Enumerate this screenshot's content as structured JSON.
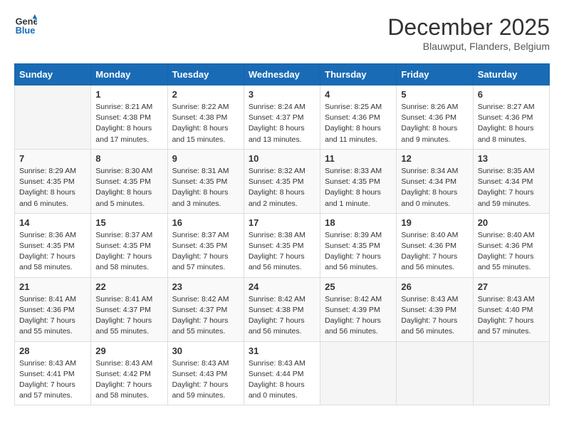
{
  "logo": {
    "line1": "General",
    "line2": "Blue"
  },
  "title": "December 2025",
  "subtitle": "Blauwput, Flanders, Belgium",
  "days_header": [
    "Sunday",
    "Monday",
    "Tuesday",
    "Wednesday",
    "Thursday",
    "Friday",
    "Saturday"
  ],
  "weeks": [
    [
      {
        "day": "",
        "info": ""
      },
      {
        "day": "1",
        "info": "Sunrise: 8:21 AM\nSunset: 4:38 PM\nDaylight: 8 hours\nand 17 minutes."
      },
      {
        "day": "2",
        "info": "Sunrise: 8:22 AM\nSunset: 4:38 PM\nDaylight: 8 hours\nand 15 minutes."
      },
      {
        "day": "3",
        "info": "Sunrise: 8:24 AM\nSunset: 4:37 PM\nDaylight: 8 hours\nand 13 minutes."
      },
      {
        "day": "4",
        "info": "Sunrise: 8:25 AM\nSunset: 4:36 PM\nDaylight: 8 hours\nand 11 minutes."
      },
      {
        "day": "5",
        "info": "Sunrise: 8:26 AM\nSunset: 4:36 PM\nDaylight: 8 hours\nand 9 minutes."
      },
      {
        "day": "6",
        "info": "Sunrise: 8:27 AM\nSunset: 4:36 PM\nDaylight: 8 hours\nand 8 minutes."
      }
    ],
    [
      {
        "day": "7",
        "info": "Sunrise: 8:29 AM\nSunset: 4:35 PM\nDaylight: 8 hours\nand 6 minutes."
      },
      {
        "day": "8",
        "info": "Sunrise: 8:30 AM\nSunset: 4:35 PM\nDaylight: 8 hours\nand 5 minutes."
      },
      {
        "day": "9",
        "info": "Sunrise: 8:31 AM\nSunset: 4:35 PM\nDaylight: 8 hours\nand 3 minutes."
      },
      {
        "day": "10",
        "info": "Sunrise: 8:32 AM\nSunset: 4:35 PM\nDaylight: 8 hours\nand 2 minutes."
      },
      {
        "day": "11",
        "info": "Sunrise: 8:33 AM\nSunset: 4:35 PM\nDaylight: 8 hours\nand 1 minute."
      },
      {
        "day": "12",
        "info": "Sunrise: 8:34 AM\nSunset: 4:34 PM\nDaylight: 8 hours\nand 0 minutes."
      },
      {
        "day": "13",
        "info": "Sunrise: 8:35 AM\nSunset: 4:34 PM\nDaylight: 7 hours\nand 59 minutes."
      }
    ],
    [
      {
        "day": "14",
        "info": "Sunrise: 8:36 AM\nSunset: 4:35 PM\nDaylight: 7 hours\nand 58 minutes."
      },
      {
        "day": "15",
        "info": "Sunrise: 8:37 AM\nSunset: 4:35 PM\nDaylight: 7 hours\nand 58 minutes."
      },
      {
        "day": "16",
        "info": "Sunrise: 8:37 AM\nSunset: 4:35 PM\nDaylight: 7 hours\nand 57 minutes."
      },
      {
        "day": "17",
        "info": "Sunrise: 8:38 AM\nSunset: 4:35 PM\nDaylight: 7 hours\nand 56 minutes."
      },
      {
        "day": "18",
        "info": "Sunrise: 8:39 AM\nSunset: 4:35 PM\nDaylight: 7 hours\nand 56 minutes."
      },
      {
        "day": "19",
        "info": "Sunrise: 8:40 AM\nSunset: 4:36 PM\nDaylight: 7 hours\nand 56 minutes."
      },
      {
        "day": "20",
        "info": "Sunrise: 8:40 AM\nSunset: 4:36 PM\nDaylight: 7 hours\nand 55 minutes."
      }
    ],
    [
      {
        "day": "21",
        "info": "Sunrise: 8:41 AM\nSunset: 4:36 PM\nDaylight: 7 hours\nand 55 minutes."
      },
      {
        "day": "22",
        "info": "Sunrise: 8:41 AM\nSunset: 4:37 PM\nDaylight: 7 hours\nand 55 minutes."
      },
      {
        "day": "23",
        "info": "Sunrise: 8:42 AM\nSunset: 4:37 PM\nDaylight: 7 hours\nand 55 minutes."
      },
      {
        "day": "24",
        "info": "Sunrise: 8:42 AM\nSunset: 4:38 PM\nDaylight: 7 hours\nand 56 minutes."
      },
      {
        "day": "25",
        "info": "Sunrise: 8:42 AM\nSunset: 4:39 PM\nDaylight: 7 hours\nand 56 minutes."
      },
      {
        "day": "26",
        "info": "Sunrise: 8:43 AM\nSunset: 4:39 PM\nDaylight: 7 hours\nand 56 minutes."
      },
      {
        "day": "27",
        "info": "Sunrise: 8:43 AM\nSunset: 4:40 PM\nDaylight: 7 hours\nand 57 minutes."
      }
    ],
    [
      {
        "day": "28",
        "info": "Sunrise: 8:43 AM\nSunset: 4:41 PM\nDaylight: 7 hours\nand 57 minutes."
      },
      {
        "day": "29",
        "info": "Sunrise: 8:43 AM\nSunset: 4:42 PM\nDaylight: 7 hours\nand 58 minutes."
      },
      {
        "day": "30",
        "info": "Sunrise: 8:43 AM\nSunset: 4:43 PM\nDaylight: 7 hours\nand 59 minutes."
      },
      {
        "day": "31",
        "info": "Sunrise: 8:43 AM\nSunset: 4:44 PM\nDaylight: 8 hours\nand 0 minutes."
      },
      {
        "day": "",
        "info": ""
      },
      {
        "day": "",
        "info": ""
      },
      {
        "day": "",
        "info": ""
      }
    ]
  ]
}
